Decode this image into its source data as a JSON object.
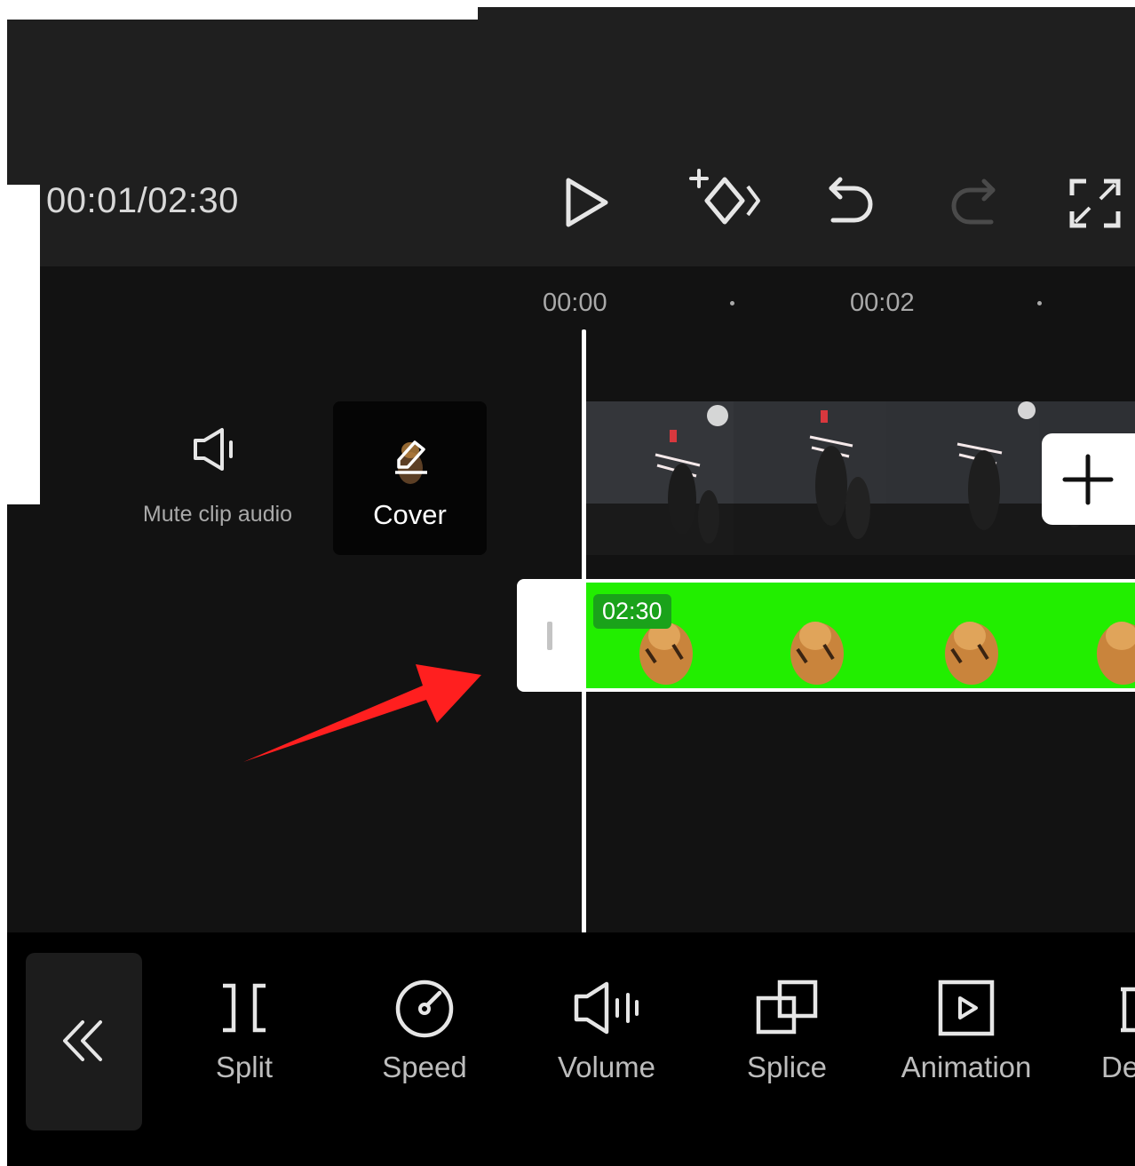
{
  "player": {
    "time_readout": "00:01/02:30",
    "icons": [
      "play-icon",
      "add-keyframe-icon",
      "undo-icon",
      "redo-icon",
      "fullscreen-icon"
    ]
  },
  "timeline": {
    "ruler": [
      "00:00",
      "00:02"
    ],
    "mute_label": "Mute clip audio",
    "cover_label": "Cover",
    "overlay_duration": "02:30",
    "colors": {
      "overlay_green": "#22ee00",
      "arrow": "#ff2020",
      "background": "#121212"
    }
  },
  "toolbar": {
    "items": [
      {
        "label": "Split",
        "icon": "split-icon"
      },
      {
        "label": "Speed",
        "icon": "speed-icon"
      },
      {
        "label": "Volume",
        "icon": "volume-icon"
      },
      {
        "label": "Splice",
        "icon": "splice-icon"
      },
      {
        "label": "Animation",
        "icon": "animation-icon"
      },
      {
        "label": "De",
        "icon": "delete-icon"
      }
    ]
  }
}
